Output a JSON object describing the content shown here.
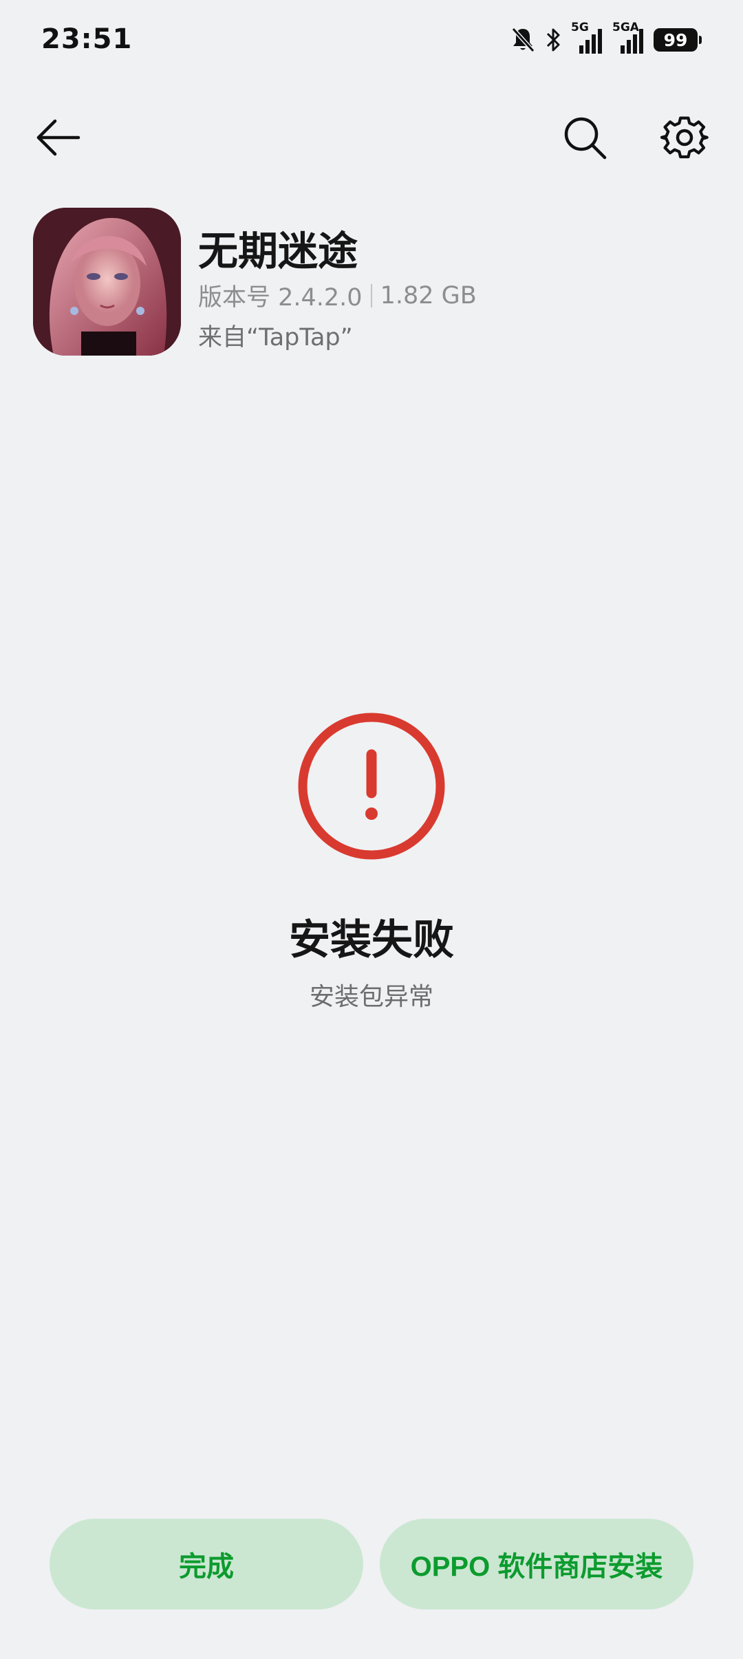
{
  "status_bar": {
    "time": "23:51",
    "network1": "5G",
    "network2": "5GA",
    "battery": "99",
    "icons": [
      "mute-bell-icon",
      "bluetooth-icon",
      "signal-icon",
      "signal-icon",
      "battery-icon"
    ]
  },
  "app_bar": {
    "back_icon": "back-arrow-icon",
    "search_icon": "search-icon",
    "settings_icon": "gear-icon"
  },
  "app": {
    "name": "无期迷途",
    "version": "版本号 2.4.2.0",
    "size": "1.82 GB",
    "source": "来自“TapTap”"
  },
  "result": {
    "icon": "error-exclamation-icon",
    "title": "安装失败",
    "subtitle": "安装包异常",
    "accent_color": "#d93a2f"
  },
  "buttons": {
    "done": "完成",
    "store_install": "OPPO 软件商店安装",
    "button_bg": "#cbe7d2",
    "button_text_color": "#0c9b2e"
  }
}
